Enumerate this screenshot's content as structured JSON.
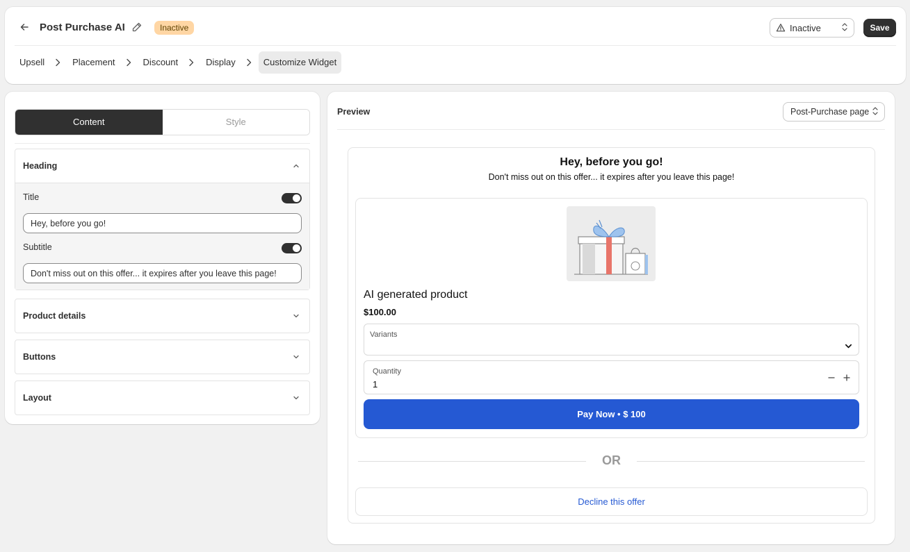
{
  "header": {
    "title": "Post Purchase AI",
    "status_badge": "Inactive",
    "status_select": "Inactive",
    "save_label": "Save"
  },
  "steps": [
    {
      "label": "Upsell"
    },
    {
      "label": "Placement"
    },
    {
      "label": "Discount"
    },
    {
      "label": "Display"
    },
    {
      "label": "Customize Widget"
    }
  ],
  "editor": {
    "tabs": {
      "content": "Content",
      "style": "Style"
    },
    "heading_section": {
      "title": "Heading",
      "title_label": "Title",
      "title_value": "Hey, before you go!",
      "subtitle_label": "Subtitle",
      "subtitle_value": "Don't miss out on this offer... it expires after you leave this page!"
    },
    "sections": [
      "Product details",
      "Buttons",
      "Layout"
    ]
  },
  "preview": {
    "label": "Preview",
    "page_select": "Post-Purchase page",
    "widget": {
      "title": "Hey, before you go!",
      "subtitle": "Don't miss out on this offer... it expires after you leave this page!",
      "product_name": "AI generated product",
      "price": "$100.00",
      "variants_label": "Variants",
      "quantity_label": "Quantity",
      "quantity_value": "1",
      "pay_button": "Pay Now • $ 100",
      "or_text": "OR",
      "decline_button": "Decline this offer"
    }
  },
  "colors": {
    "primary_blue": "#2559d3",
    "dark": "#303030",
    "badge_bg": "#ffd6a4"
  }
}
